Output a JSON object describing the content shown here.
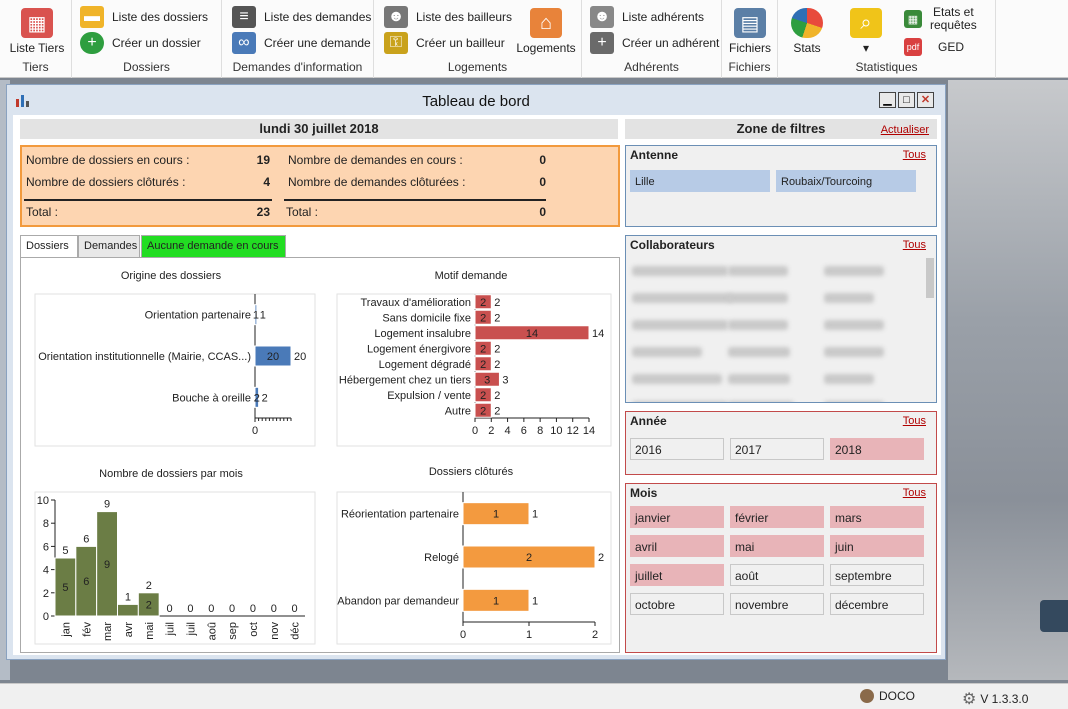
{
  "ribbon": {
    "groups": [
      {
        "label": "Tiers",
        "buttons": [
          {
            "label": "Liste Tiers",
            "icon": "calendar-person-icon"
          }
        ]
      },
      {
        "label": "Dossiers",
        "buttons": [
          {
            "label": "Liste des dossiers",
            "icon": "folder-icon"
          },
          {
            "label": "Créer un dossier",
            "icon": "add-circle-icon"
          }
        ]
      },
      {
        "label": "Demandes d'information",
        "buttons": [
          {
            "label": "Liste des demandes",
            "icon": "list-icon"
          },
          {
            "label": "Créer une demande",
            "icon": "add-link-icon"
          }
        ]
      },
      {
        "label": "Logements",
        "buttons": [
          {
            "label": "Liste des bailleurs",
            "icon": "person-key-icon"
          },
          {
            "label": "Créer un bailleur",
            "icon": "add-key-icon"
          },
          {
            "label": "Logements",
            "icon": "house-icon"
          }
        ]
      },
      {
        "label": "Adhérents",
        "buttons": [
          {
            "label": "Liste adhérents",
            "icon": "group-icon"
          },
          {
            "label": "Créer un adhérent",
            "icon": "add-person-icon"
          }
        ]
      },
      {
        "label": "Fichiers",
        "buttons": [
          {
            "label": "Fichiers",
            "icon": "file-icon"
          }
        ]
      },
      {
        "label": "Statistiques",
        "buttons": [
          {
            "label": "Stats",
            "icon": "pie-chart-icon"
          },
          {
            "label": "▾",
            "icon": "magnifier-chart-icon"
          },
          {
            "label": "Etats et\nrequêtes",
            "icon": "report-icon"
          },
          {
            "label": "GED",
            "icon": "pdf-icon"
          }
        ]
      }
    ]
  },
  "window": {
    "title": "Tableau de bord"
  },
  "date": "lundi 30 juillet 2018",
  "summary": {
    "dossiers_en_cours_label": "Nombre de dossiers en cours :",
    "dossiers_en_cours": "19",
    "dossiers_clotures_label": "Nombre de dossiers clôturés :",
    "dossiers_clotures": "4",
    "demandes_en_cours_label": "Nombre de demandes en cours :",
    "demandes_en_cours": "0",
    "demandes_cloturees_label": "Nombre de demandes clôturées :",
    "demandes_cloturees": "0",
    "total_label": "Total :",
    "total_dossiers": "23",
    "total_demandes": "0"
  },
  "tabs": [
    {
      "label": "Dossiers",
      "active": true
    },
    {
      "label": "Demandes",
      "active": false
    },
    {
      "label": "Aucune demande en cours",
      "active": false,
      "color": "#22dd22"
    }
  ],
  "chart_data": [
    {
      "type": "bar",
      "orientation": "horizontal",
      "title": "Origine des dossiers",
      "categories": [
        "Orientation partenaire",
        "Orientation institutionnelle (Mairie, CCAS...)",
        "Bouche à oreille"
      ],
      "values": [
        1,
        20,
        2
      ],
      "color": "#4a7ab8",
      "xlim": [
        0,
        20
      ],
      "tick_labels": [
        "0"
      ]
    },
    {
      "type": "bar",
      "orientation": "horizontal",
      "title": "Motif demande",
      "categories": [
        "Travaux d'amélioration",
        "Sans domicile fixe",
        "Logement insalubre",
        "Logement énergivore",
        "Logement dégradé",
        "Hébergement chez un tiers",
        "Expulsion / vente",
        "Autre"
      ],
      "values": [
        2,
        2,
        14,
        2,
        2,
        3,
        2,
        2
      ],
      "color": "#c9504f",
      "xlim": [
        0,
        14
      ],
      "tick_labels": [
        "0",
        "2",
        "4",
        "6",
        "8",
        "10",
        "12",
        "14"
      ]
    },
    {
      "type": "bar",
      "orientation": "vertical",
      "title": "Nombre de dossiers par mois",
      "categories": [
        "jan",
        "fév",
        "mar",
        "avr",
        "mai",
        "juil",
        "juil",
        "aoû",
        "sep",
        "oct",
        "nov",
        "déc"
      ],
      "values": [
        5,
        6,
        9,
        1,
        2,
        0,
        0,
        0,
        0,
        0,
        0,
        0
      ],
      "color": "#6b7d45",
      "ylim": [
        0,
        10
      ],
      "tick_labels": [
        "0",
        "2",
        "4",
        "6",
        "8",
        "10"
      ]
    },
    {
      "type": "bar",
      "orientation": "horizontal",
      "title": "Dossiers clôturés",
      "categories": [
        "Réorientation partenaire",
        "Relogé",
        "Abandon par demandeur"
      ],
      "values": [
        1,
        2,
        1
      ],
      "color": "#f39a3f",
      "xlim": [
        0,
        2
      ],
      "tick_labels": [
        "0",
        "1",
        "2"
      ]
    }
  ],
  "filters": {
    "title": "Zone de filtres",
    "refresh": "Actualiser",
    "all": "Tous",
    "antenne": {
      "label": "Antenne",
      "items": [
        "Lille",
        "Roubaix/Tourcoing"
      ]
    },
    "collaborateurs": {
      "label": "Collaborateurs"
    },
    "annee": {
      "label": "Année",
      "items": [
        "2016",
        "2017",
        "2018"
      ],
      "selected": [
        "2018"
      ]
    },
    "mois": {
      "label": "Mois",
      "items": [
        "janvier",
        "février",
        "mars",
        "avril",
        "mai",
        "juin",
        "juillet",
        "août",
        "septembre",
        "octobre",
        "novembre",
        "décembre"
      ],
      "selected": [
        "janvier",
        "février",
        "mars",
        "avril",
        "mai",
        "juin",
        "juillet"
      ]
    }
  },
  "status": {
    "user": "DOCO",
    "version": "V 1.3.3.0"
  }
}
